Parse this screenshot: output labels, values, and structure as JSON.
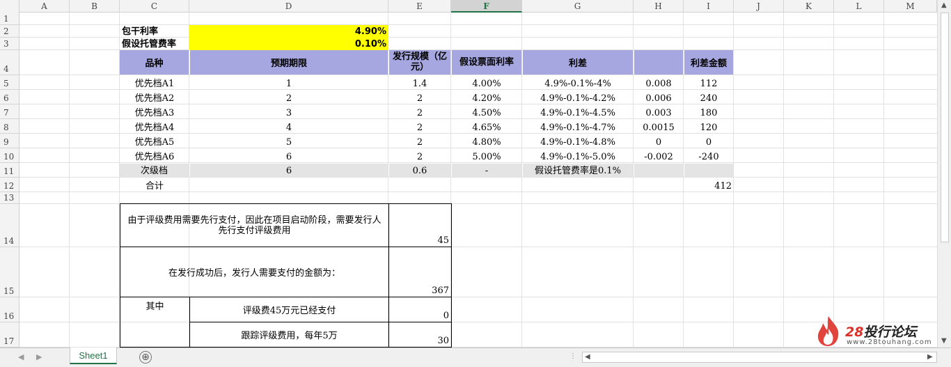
{
  "columns": [
    "A",
    "B",
    "C",
    "D",
    "E",
    "F",
    "G",
    "H",
    "I",
    "J",
    "K",
    "L",
    "M"
  ],
  "rows": [
    "1",
    "2",
    "3",
    "4",
    "5",
    "6",
    "7",
    "8",
    "9",
    "10",
    "11",
    "12",
    "13",
    "14",
    "15",
    "16",
    "17"
  ],
  "header_cells": {
    "c2": "包干利率",
    "d2": "4.90%",
    "c3": "假设托管费率",
    "d3": "0.10%"
  },
  "table_headers": {
    "variety": "品种",
    "term": "预期期限",
    "scale": "发行规模（亿元）",
    "coupon": "假设票面利率",
    "spread": "利差",
    "blank": "",
    "spread_amount": "利差金额"
  },
  "table_rows": [
    {
      "name": "优先档A1",
      "term": "1",
      "scale": "1.4",
      "coupon": "4.00%",
      "spread": "4.9%-0.1%-4%",
      "diff": "0.008",
      "amount": "112"
    },
    {
      "name": "优先档A2",
      "term": "2",
      "scale": "2",
      "coupon": "4.20%",
      "spread": "4.9%-0.1%-4.2%",
      "diff": "0.006",
      "amount": "240"
    },
    {
      "name": "优先档A3",
      "term": "3",
      "scale": "2",
      "coupon": "4.50%",
      "spread": "4.9%-0.1%-4.5%",
      "diff": "0.003",
      "amount": "180"
    },
    {
      "name": "优先档A4",
      "term": "4",
      "scale": "2",
      "coupon": "4.65%",
      "spread": "4.9%-0.1%-4.7%",
      "diff": "0.0015",
      "amount": "120"
    },
    {
      "name": "优先档A5",
      "term": "5",
      "scale": "2",
      "coupon": "4.80%",
      "spread": "4.9%-0.1%-4.8%",
      "diff": "0",
      "amount": "0"
    },
    {
      "name": "优先档A6",
      "term": "6",
      "scale": "2",
      "coupon": "5.00%",
      "spread": "4.9%-0.1%-5.0%",
      "diff": "-0.002",
      "amount": "-240"
    }
  ],
  "subordinate": {
    "name": "次级档",
    "term": "6",
    "scale": "0.6",
    "coupon": "-",
    "note": "假设托管费率是0.1%"
  },
  "total": {
    "label": "合计",
    "amount": "412"
  },
  "fee_box": {
    "row14_text": "由于评级费用需要先行支付，因此在项目启动阶段，需要发行人先行支付评级费用",
    "row14_value": "45",
    "row15_text": "在发行成功后，发行人需要支付的金额为：",
    "row15_value": "367",
    "row16_label": "其中",
    "row16_text": "评级费45万元已经支付",
    "row16_value": "0",
    "row17_text": "跟踪评级费用，每年5万",
    "row17_value": "30"
  },
  "sheet_tab": "Sheet1",
  "add_sheet": "⊕",
  "watermark": {
    "num": "28",
    "name": "投行论坛",
    "url": "www.28touhang.com"
  },
  "colors": {
    "yellow": "#ffff00",
    "purple": "#a6a6e0",
    "gray": "#e4e4e4",
    "accent": "#217346"
  }
}
